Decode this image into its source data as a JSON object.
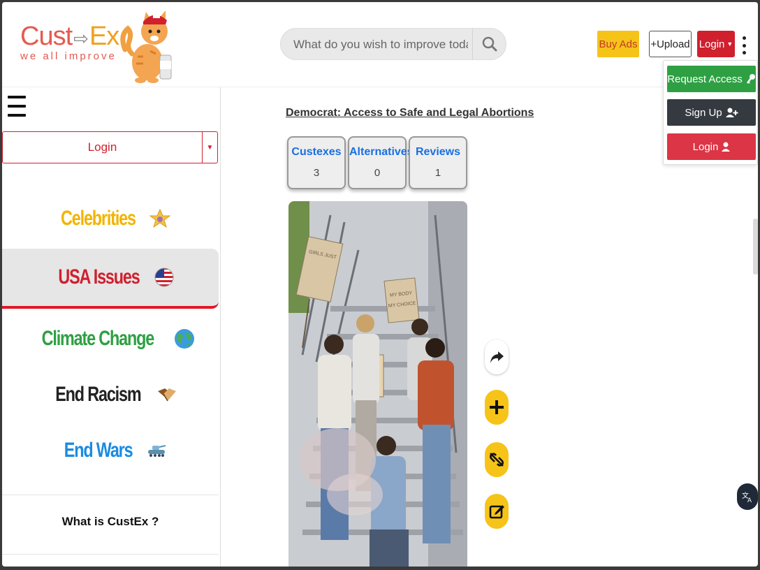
{
  "header": {
    "logo": {
      "word1": "Cust",
      "arrow": "⇨",
      "word2": "Ex",
      "tagline": "we all improve"
    },
    "search": {
      "placeholder": "What do you wish to improve today?"
    },
    "buy_ads": "Buy Ads",
    "upload": "+Upload",
    "login": "Login",
    "icons": {
      "search": "search-icon",
      "menu": "kebab-menu-icon"
    }
  },
  "dropdown": {
    "items": [
      {
        "label": "Request Access",
        "icon": "key-icon",
        "color": "#2ea043"
      },
      {
        "label": "Sign Up",
        "icon": "user-plus-icon",
        "color": "#343a40"
      },
      {
        "label": "Login",
        "icon": "user-icon",
        "color": "#dc3545"
      }
    ]
  },
  "sidebar": {
    "login_label": "Login",
    "categories": [
      {
        "label": "Celebrities",
        "icon": "star-icon",
        "color": "#f2b400"
      },
      {
        "label": "USA Issues",
        "icon": "us-flag-icon",
        "color": "#d0202e",
        "active": true
      },
      {
        "label": "Climate Change",
        "icon": "globe-icon",
        "color": "#2ea043"
      },
      {
        "label": "End Racism",
        "icon": "handshake-icon",
        "color": "#222222"
      },
      {
        "label": "End Wars",
        "icon": "tank-icon",
        "color": "#1a8be0"
      }
    ],
    "what_is": "What is CustEx ?"
  },
  "main": {
    "issue_title": "Democrat: Access to Safe and Legal Abortions",
    "tabs": [
      {
        "label": "Custexes",
        "count": "3"
      },
      {
        "label": "Alternatives",
        "count": "0"
      },
      {
        "label": "Reviews",
        "count": "1"
      }
    ],
    "photo": {
      "sign1": "GIRLS JUST WANNA HAVE FUN-DAMENTAL RIGHTS",
      "sign2": "MY BODY MY CHOICE"
    },
    "actions": [
      "share-icon",
      "plus-icon",
      "unlink-icon",
      "edit-icon"
    ]
  },
  "colors": {
    "brand_red": "#d0202e",
    "brand_yellow": "#f6c318",
    "link_blue": "#1a6fe0"
  }
}
